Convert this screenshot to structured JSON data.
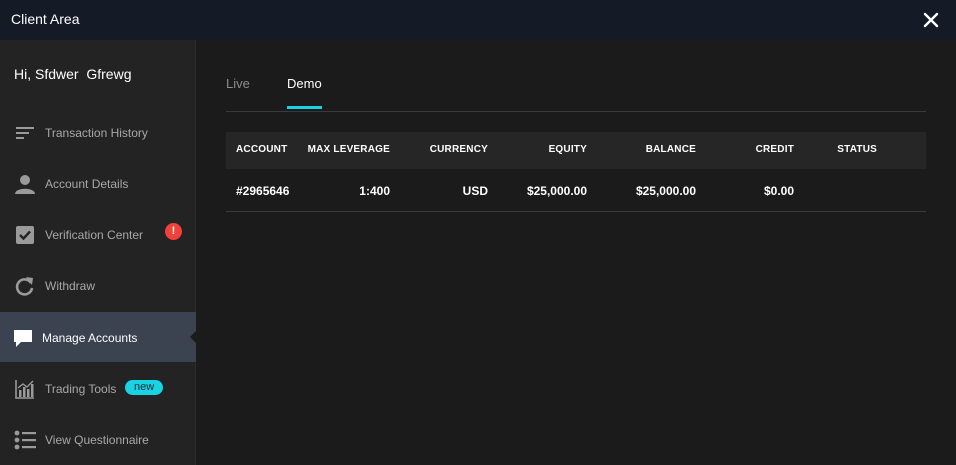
{
  "window": {
    "title": "Client Area"
  },
  "sidebar": {
    "greeting": "Hi, Sfdwer  Gfrewg",
    "items": [
      {
        "label": "Transaction History",
        "icon": "lines-icon"
      },
      {
        "label": "Account Details",
        "icon": "user-icon"
      },
      {
        "label": "Verification Center",
        "icon": "check-icon",
        "badge": "!"
      },
      {
        "label": "Withdraw",
        "icon": "refresh-icon"
      },
      {
        "label": "Manage Accounts",
        "icon": "chat-icon",
        "active": true
      },
      {
        "label": "Trading Tools",
        "icon": "chart-icon",
        "badge": "new"
      },
      {
        "label": "View Questionnaire",
        "icon": "list-icon"
      }
    ]
  },
  "tabs": [
    {
      "label": "Live"
    },
    {
      "label": "Demo",
      "active": true
    }
  ],
  "table": {
    "headers": [
      "ACCOUNT",
      "MAX LEVERAGE",
      "CURRENCY",
      "EQUITY",
      "BALANCE",
      "CREDIT",
      "STATUS"
    ],
    "rows": [
      [
        "#2965646",
        "1:400",
        "USD",
        "$25,000.00",
        "$25,000.00",
        "$0.00",
        ""
      ]
    ]
  },
  "colors": {
    "accent": "#19d3e3",
    "alert": "#f0413b",
    "titlebar": "#141a26",
    "active_item": "#3b4250"
  }
}
